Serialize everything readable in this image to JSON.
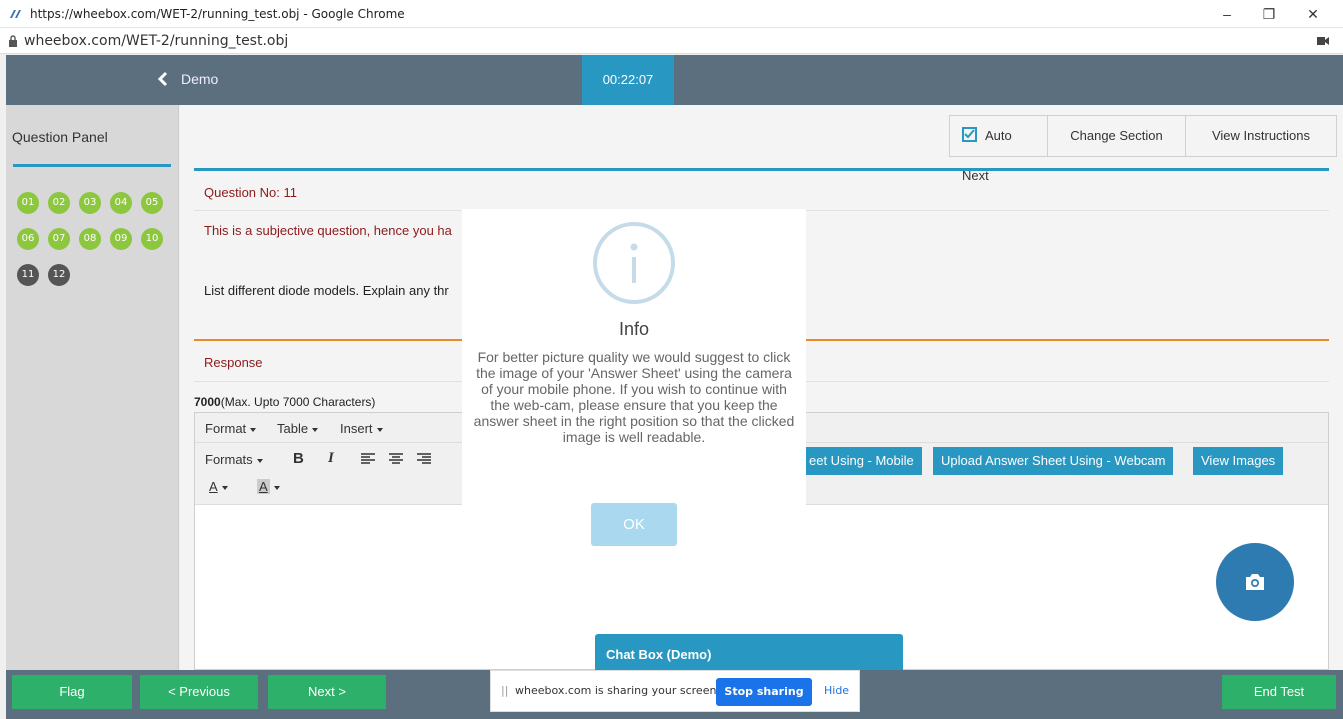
{
  "browser": {
    "window_title": "https://wheebox.com/WET-2/running_test.obj - Google Chrome",
    "address": "wheebox.com/WET-2/running_test.obj",
    "minimize": "–",
    "restore": "❐",
    "close": "✕"
  },
  "header": {
    "back_icon": "chevron-left-icon",
    "title": "Demo",
    "timer": "00:22:07"
  },
  "question_panel": {
    "title": "Question Panel",
    "questions": [
      {
        "label": "01",
        "status": "answered"
      },
      {
        "label": "02",
        "status": "answered"
      },
      {
        "label": "03",
        "status": "answered"
      },
      {
        "label": "04",
        "status": "answered"
      },
      {
        "label": "05",
        "status": "answered"
      },
      {
        "label": "06",
        "status": "answered"
      },
      {
        "label": "07",
        "status": "answered"
      },
      {
        "label": "08",
        "status": "answered"
      },
      {
        "label": "09",
        "status": "answered"
      },
      {
        "label": "10",
        "status": "answered"
      },
      {
        "label": "11",
        "status": "current"
      },
      {
        "label": "12",
        "status": "not_visited"
      }
    ]
  },
  "toolbar": {
    "auto_next": "Auto Next",
    "auto_next_checked": true,
    "change_section": "Change Section",
    "view_instructions": "View Instructions"
  },
  "question": {
    "number": "Question No: 11",
    "note": "This is a subjective question, hence you ha",
    "text": "List different diode models. Explain any thr"
  },
  "response": {
    "label": "Response",
    "count": "7000",
    "limit": "(Max. Upto 7000 Characters)"
  },
  "editor": {
    "menu": [
      "Format",
      "Table",
      "Insert"
    ],
    "formats": "Formats",
    "bold": "B",
    "italic": "I",
    "font_color": "A",
    "bg_color": "A"
  },
  "upload": {
    "mobile": "eet Using - Mobile",
    "webcam": "Upload Answer Sheet Using - Webcam",
    "view_images": "View Images"
  },
  "chat": {
    "title": "Chat Box (Demo)"
  },
  "modal": {
    "title": "Info",
    "body": "For better picture quality we would suggest to click the image of your 'Answer Sheet' using the camera of your mobile phone. If you wish to continue with the web-cam, please ensure that you keep the answer sheet in the right position so that the clicked image is well readable.",
    "ok": "OK"
  },
  "footer": {
    "flag": "Flag",
    "previous": "< Previous",
    "next": "Next >",
    "end_test": "End Test"
  },
  "share": {
    "handle": "||",
    "message": "wheebox.com is sharing your screen.",
    "stop": "Stop sharing",
    "hide": "Hide"
  },
  "colors": {
    "accent": "#2897c1",
    "header": "#5b6f7e",
    "answered": "#8dc63f",
    "not_visited": "#555555",
    "green_button": "#2db069"
  }
}
